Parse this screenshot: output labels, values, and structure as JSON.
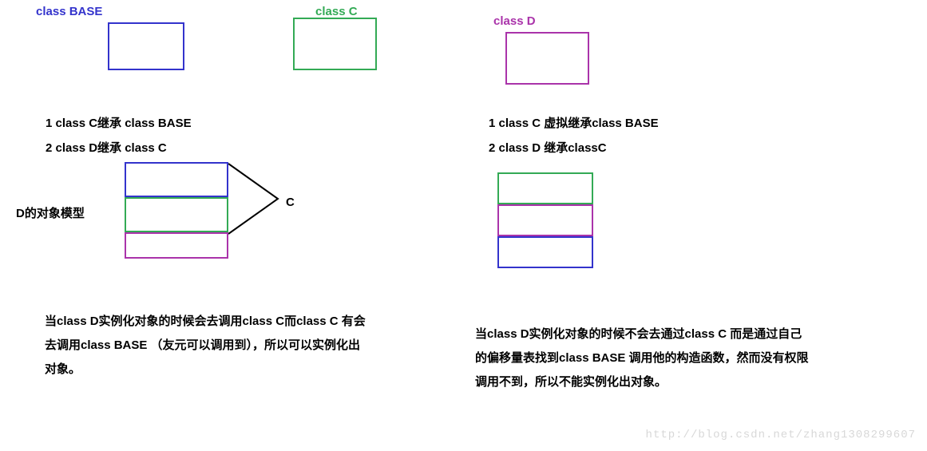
{
  "header": {
    "classBase": "class BASE",
    "classC": "class C",
    "classD": "class D"
  },
  "left": {
    "rule1": "1  class C继承 class BASE",
    "rule2": "2  class D继承 class C",
    "modelLabel": "D的对象模型",
    "bracketLabel": "C",
    "paragraph": "当class D实例化对象的时候会去调用class C而class C 有会去调用class BASE （友元可以调用到），所以可以实例化出对象。"
  },
  "right": {
    "rule1": "1 class C  虚拟继承class BASE",
    "rule2": "2 class D  继承classC",
    "paragraph": "当class D实例化对象的时候不会去通过class C  而是通过自己的偏移量表找到class BASE 调用他的构造函数，然而没有权限调用不到，所以不能实例化出对象。"
  },
  "watermark": "http://blog.csdn.net/zhang1308299607",
  "colors": {
    "base": "#3333cc",
    "c": "#33aa55",
    "d": "#aa33aa"
  }
}
